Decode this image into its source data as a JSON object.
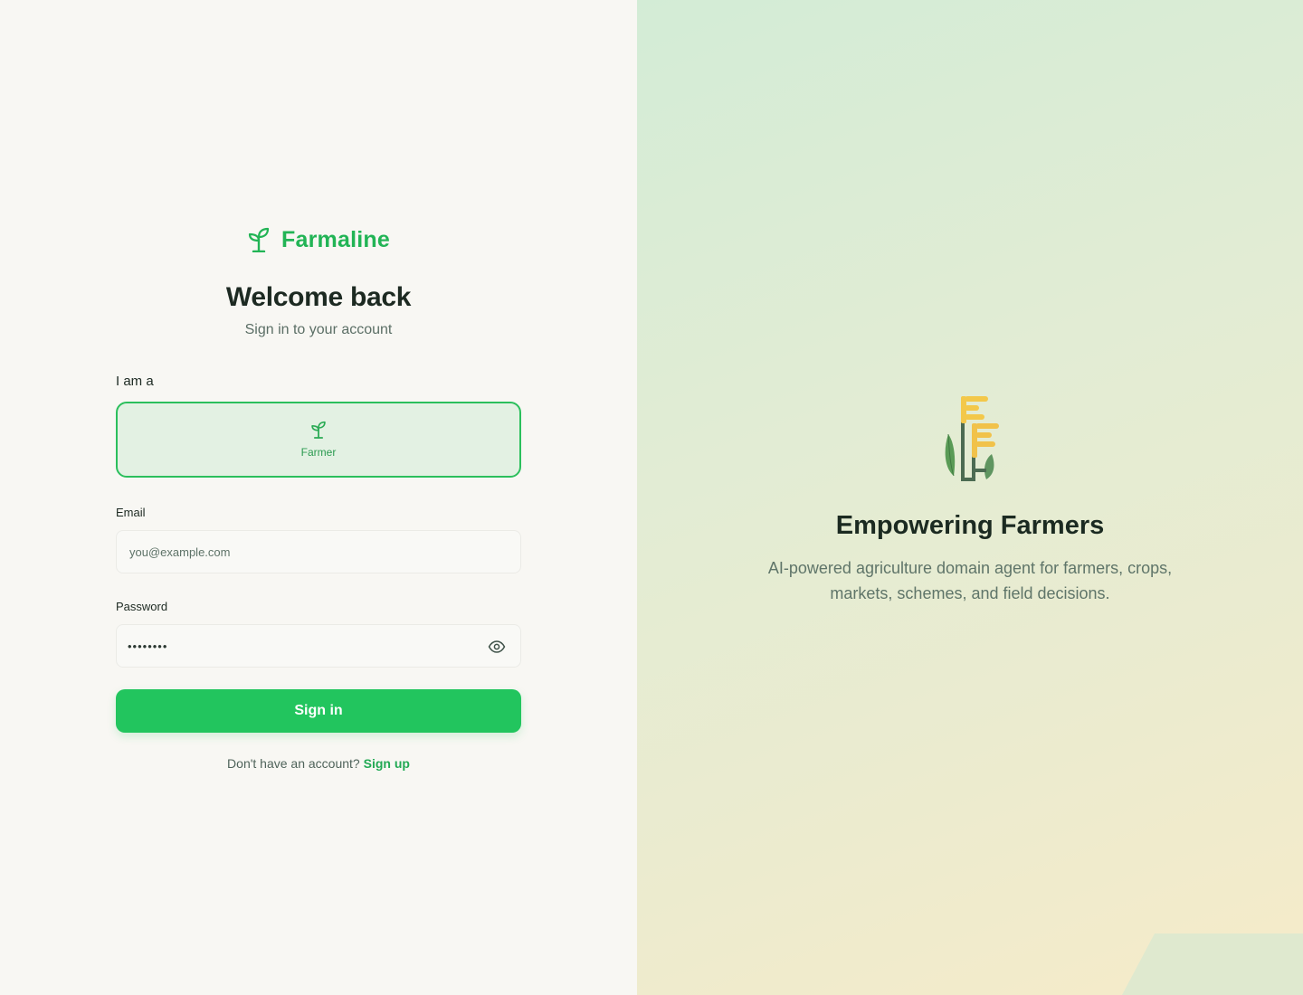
{
  "brand": {
    "name": "Farmaline",
    "icon": "sprout-icon",
    "color": "#22b455"
  },
  "login": {
    "title": "Welcome back",
    "subtitle": "Sign in to your account",
    "role_label": "I am a",
    "roles": [
      {
        "label": "Farmer",
        "icon": "sprout-icon",
        "selected": true
      }
    ],
    "email": {
      "label": "Email",
      "value": "",
      "placeholder": "you@example.com"
    },
    "password": {
      "label": "Password",
      "masked_value": "••••••••",
      "toggle_icon": "eye-icon"
    },
    "submit_label": "Sign in",
    "footer_text": "Don't have an account?",
    "footer_link": "Sign up"
  },
  "hero": {
    "icon": "wheat-icon",
    "title": "Empowering Farmers",
    "description": "AI-powered agriculture domain agent for farmers, crops, markets, schemes, and field decisions."
  },
  "colors": {
    "accent": "#22c55e",
    "accent_dark": "#22a954",
    "selected_card_bg": "#e3f1e3",
    "left_bg": "#f8f7f3"
  }
}
